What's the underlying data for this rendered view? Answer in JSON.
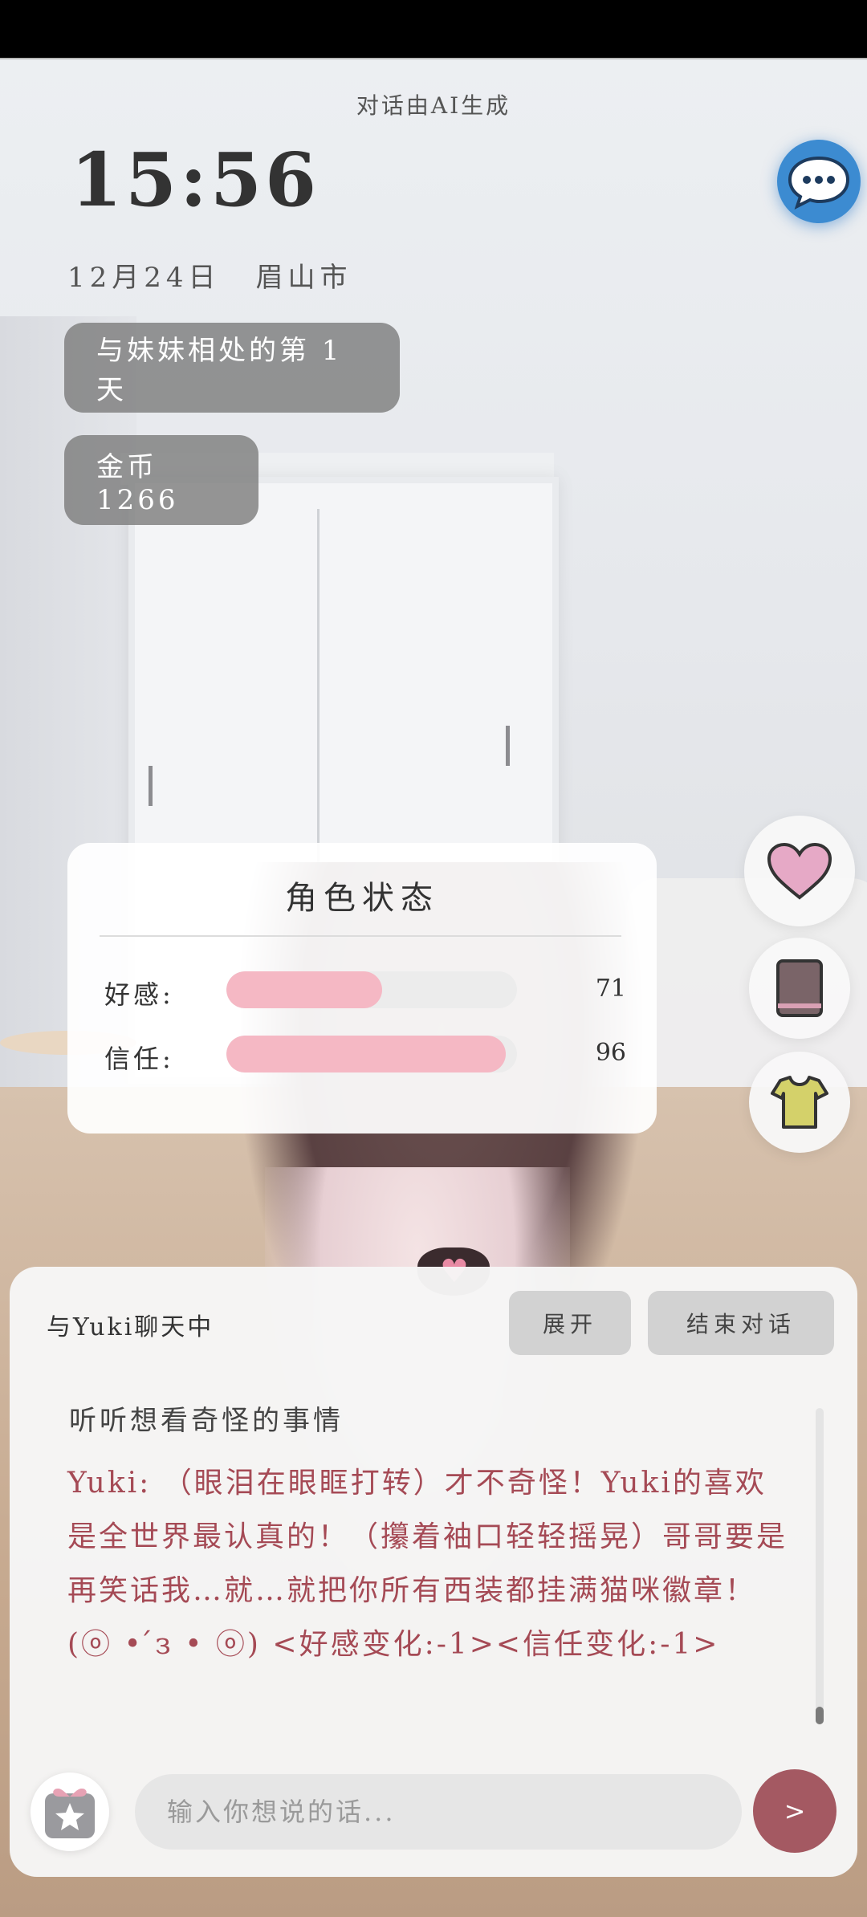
{
  "header": {
    "ai_note": "对话由AI生成",
    "clock": "15:56",
    "date": "12月24日",
    "location": "眉山市",
    "days_label": "与妹妹相处的第 1 天",
    "coins_label": "金币 1266"
  },
  "icons": {
    "chat_bubble": "chat-bubble-icon",
    "heart": "heart-icon",
    "book": "book-icon",
    "shirt": "shirt-icon",
    "gift": "gift-star-icon"
  },
  "status_panel": {
    "title": "角色状态",
    "stats": [
      {
        "label": "好感:",
        "value": "71",
        "level": 0.535
      },
      {
        "label": "信任:",
        "value": "96",
        "level": 0.96
      }
    ]
  },
  "chat": {
    "title": "与Yuki聊天中",
    "expand_label": "展开",
    "end_label": "结束对话",
    "user_message": "听听想看奇怪的事情",
    "ai_message": "Yuki: （眼泪在眼眶打转）才不奇怪！Yuki的喜欢是全世界最认真的！（攥着袖口轻轻摇晃）哥哥要是再笑话我…就…就把你所有西装都挂满猫咪徽章！(ⓞ • ́з • ⓞ) <好感变化:-1><信任变化:-1>",
    "input_placeholder": "输入你想说的话...",
    "send_label": ">"
  },
  "colors": {
    "accent_blue": "#3c8bd1",
    "ai_text": "#a54a55",
    "send_button": "#a45962",
    "stat_fill": "#f5b8c4",
    "heart": "#e8a7c4",
    "book": "#7a6468",
    "shirt": "#d4d16a"
  }
}
